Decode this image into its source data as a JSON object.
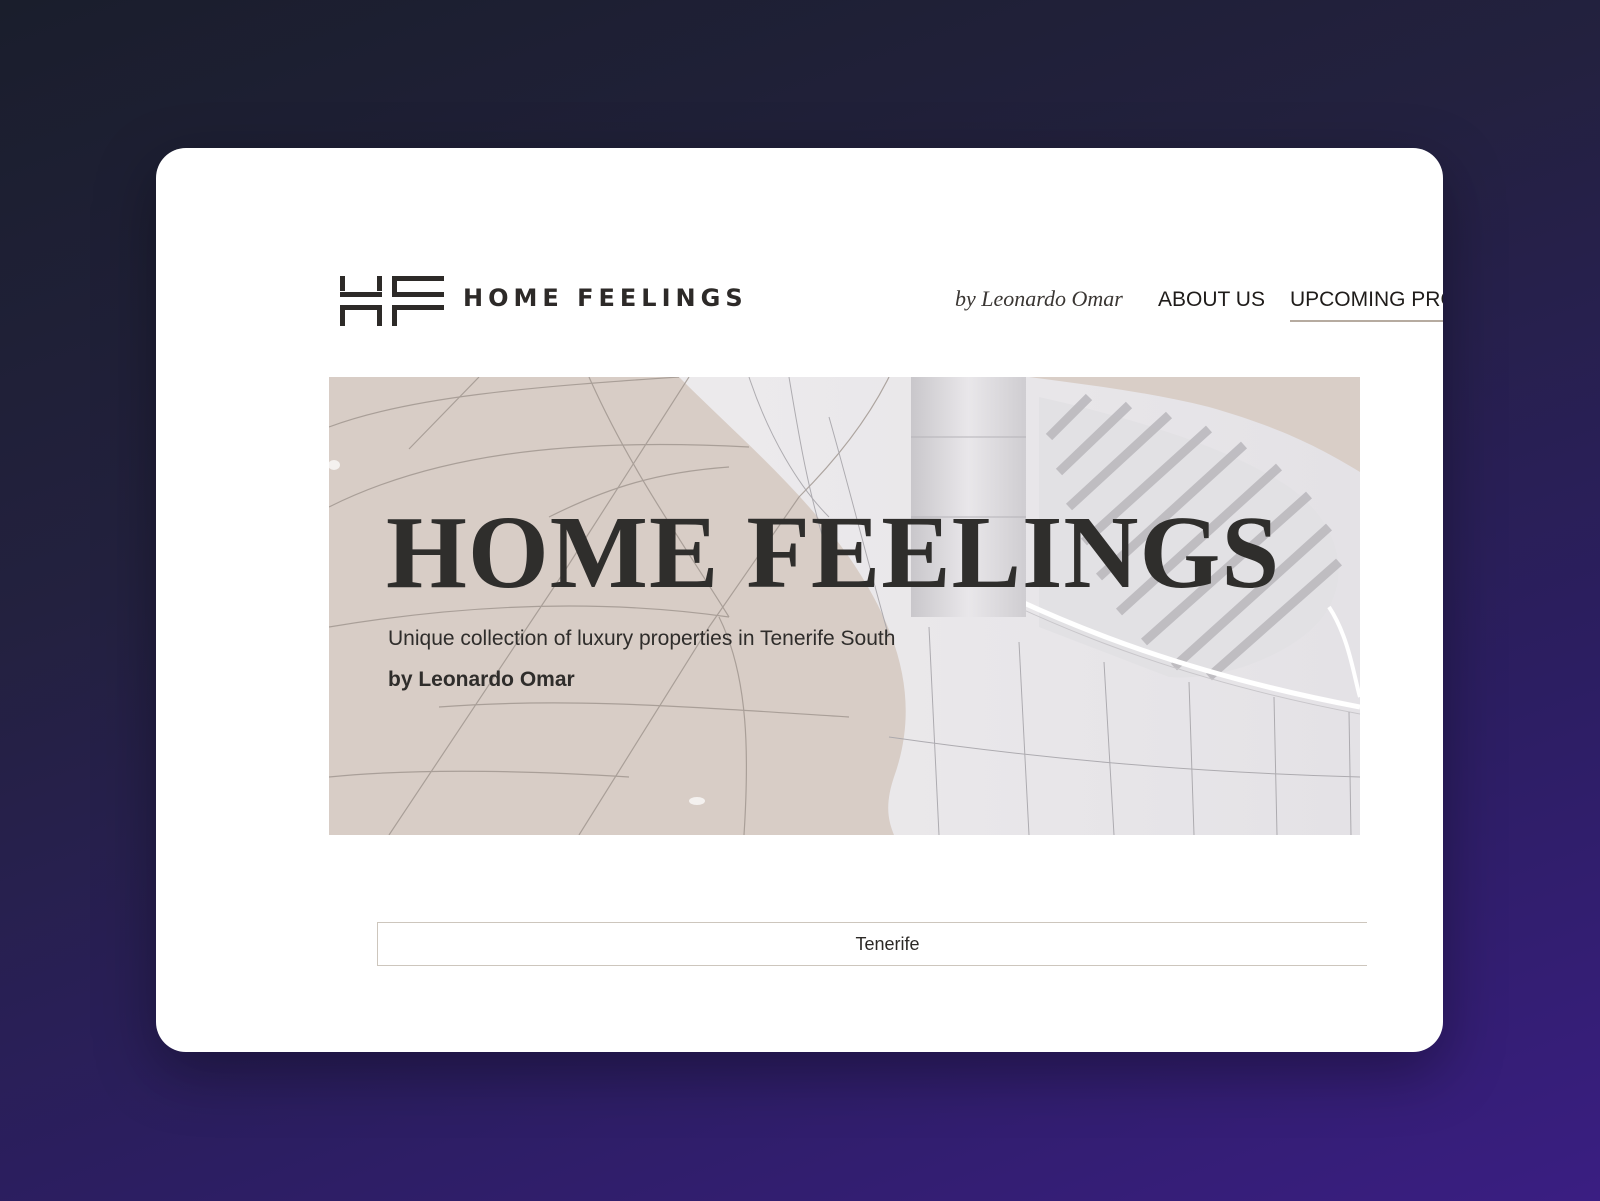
{
  "header": {
    "logo_icon": "hf-monogram-icon",
    "brand_name": "HOME FEELINGS",
    "brand_byline": "by Leonardo Omar"
  },
  "nav": {
    "items": [
      {
        "label": "ABOUT US",
        "active": false
      },
      {
        "label": "UPCOMING PROJECTS",
        "active": true
      }
    ]
  },
  "hero": {
    "title": "HOME FEELINGS",
    "subtitle": "Unique collection of luxury properties in Tenerife South",
    "byline": "by Leonardo Omar"
  },
  "location": {
    "label": "Tenerife"
  },
  "colors": {
    "text_dark": "#2d2a28",
    "accent_underline": "#b6aba0",
    "hero_beige": "#d6cbc4",
    "card_bg": "#ffffff"
  }
}
